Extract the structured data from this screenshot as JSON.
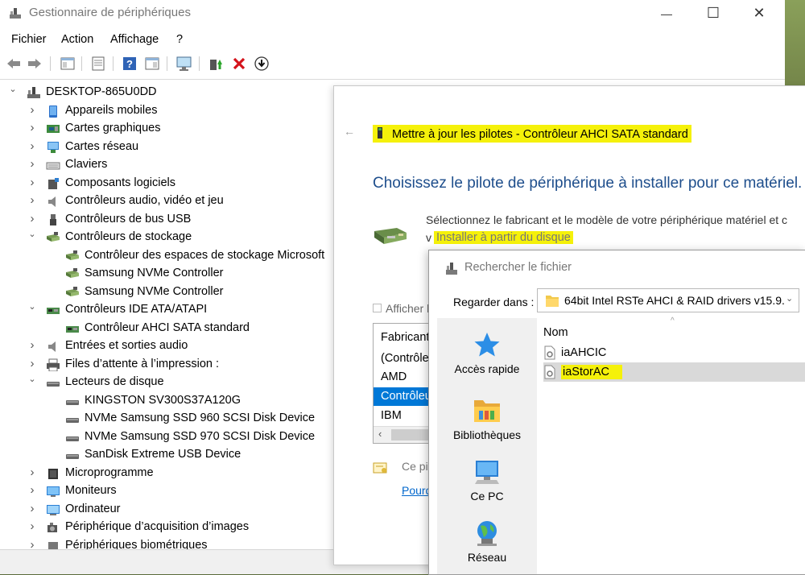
{
  "window": {
    "title": "Gestionnaire de périphériques",
    "controls": {
      "minimize": "—",
      "maximize": "☐",
      "close": "✕"
    }
  },
  "menu": [
    "Fichier",
    "Action",
    "Affichage",
    "?"
  ],
  "tree": {
    "root": "DESKTOP-865U0DD",
    "items": [
      {
        "label": "Appareils mobiles",
        "icon": "mobile-device-icon",
        "level": 1,
        "state": "collapsed"
      },
      {
        "label": "Cartes graphiques",
        "icon": "display-adapter-icon",
        "level": 1,
        "state": "collapsed"
      },
      {
        "label": "Cartes réseau",
        "icon": "network-adapter-icon",
        "level": 1,
        "state": "collapsed"
      },
      {
        "label": "Claviers",
        "icon": "keyboard-icon",
        "level": 1,
        "state": "collapsed"
      },
      {
        "label": "Composants logiciels",
        "icon": "software-component-icon",
        "level": 1,
        "state": "collapsed"
      },
      {
        "label": "Contrôleurs audio, vidéo et jeu",
        "icon": "audio-icon",
        "level": 1,
        "state": "collapsed"
      },
      {
        "label": "Contrôleurs de bus USB",
        "icon": "usb-icon",
        "level": 1,
        "state": "collapsed"
      },
      {
        "label": "Contrôleurs de stockage",
        "icon": "storage-controller-icon",
        "level": 1,
        "state": "expanded"
      },
      {
        "label": "Contrôleur des espaces de stockage Microsoft",
        "icon": "storage-controller-icon",
        "level": 2,
        "state": "leaf"
      },
      {
        "label": "Samsung NVMe Controller",
        "icon": "storage-controller-icon",
        "level": 2,
        "state": "leaf"
      },
      {
        "label": "Samsung NVMe Controller",
        "icon": "storage-controller-icon",
        "level": 2,
        "state": "leaf"
      },
      {
        "label": "Contrôleurs IDE ATA/ATAPI",
        "icon": "ide-controller-icon",
        "level": 1,
        "state": "expanded"
      },
      {
        "label": "Contrôleur AHCI SATA standard",
        "icon": "ide-controller-icon",
        "level": 2,
        "state": "leaf"
      },
      {
        "label": "Entrées et sorties audio",
        "icon": "speaker-icon",
        "level": 1,
        "state": "collapsed"
      },
      {
        "label": "Files d’attente à l’impression :",
        "icon": "printer-icon",
        "level": 1,
        "state": "collapsed"
      },
      {
        "label": "Lecteurs de disque",
        "icon": "disk-drive-icon",
        "level": 1,
        "state": "expanded"
      },
      {
        "label": "KINGSTON SV300S37A120G",
        "icon": "disk-drive-icon",
        "level": 2,
        "state": "leaf"
      },
      {
        "label": "NVMe Samsung SSD 960 SCSI Disk Device",
        "icon": "disk-drive-icon",
        "level": 2,
        "state": "leaf"
      },
      {
        "label": "NVMe Samsung SSD 970 SCSI Disk Device",
        "icon": "disk-drive-icon",
        "level": 2,
        "state": "leaf"
      },
      {
        "label": "SanDisk Extreme USB Device",
        "icon": "disk-drive-icon",
        "level": 2,
        "state": "leaf"
      },
      {
        "label": "Microprogramme",
        "icon": "firmware-icon",
        "level": 1,
        "state": "collapsed"
      },
      {
        "label": "Moniteurs",
        "icon": "monitor-icon",
        "level": 1,
        "state": "collapsed"
      },
      {
        "label": "Ordinateur",
        "icon": "computer-icon",
        "level": 1,
        "state": "collapsed"
      },
      {
        "label": "Périphérique d’acquisition d’images",
        "icon": "camera-icon",
        "level": 1,
        "state": "collapsed"
      },
      {
        "label": "Périphériques biométriques",
        "icon": "biometric-icon",
        "level": 1,
        "state": "collapsed"
      }
    ]
  },
  "wizard": {
    "title": "Mettre à jour les pilotes - Contrôleur AHCI SATA standard",
    "heading": "Choisissez le pilote de périphérique à installer pour ce matériel.",
    "description": "Sélectionnez le fabricant et le modèle de votre périphérique matériel et c",
    "description_line2": "v",
    "install_from_disk": "Installer à partir du disque",
    "show_compatible": "Afficher l",
    "manufacturer_header": "Fabricant",
    "manufacturers": [
      "(Contrôle",
      "AMD",
      "Contrôleu",
      "IBM"
    ],
    "selected_manufacturer_index": 2,
    "signed_text": "Ce pilo",
    "why_link": "Pourqu"
  },
  "file_dialog": {
    "title": "Rechercher le fichier",
    "look_in_label": "Regarder dans :",
    "look_in_value": "64bit Intel RSTe AHCI & RAID drivers v15.9.",
    "places": [
      "Accès rapide",
      "Bibliothèques",
      "Ce PC",
      "Réseau"
    ],
    "column_name": "Nom",
    "files": [
      "iaAHCIC",
      "iaStorAC"
    ],
    "selected_file_index": 1
  },
  "colors": {
    "highlight": "#f5f10a",
    "heading_blue": "#1e4e8c",
    "selection_blue": "#0078d7",
    "link_blue": "#0066cc"
  }
}
